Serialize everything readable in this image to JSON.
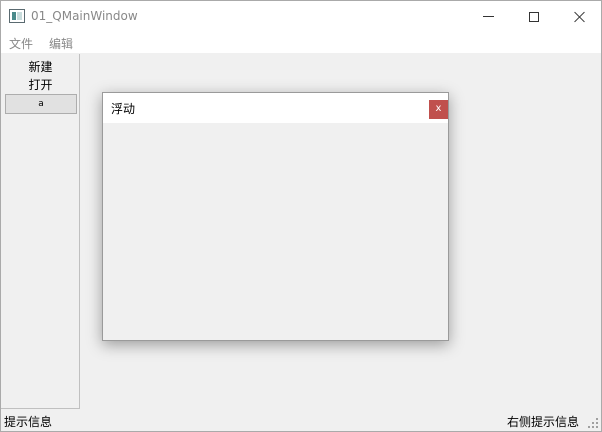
{
  "window": {
    "title": "01_QMainWindow",
    "icon": "app-window-icon"
  },
  "menubar": {
    "file_label": "文件",
    "edit_label": "编辑"
  },
  "dock": {
    "new_label": "新建",
    "open_label": "打开",
    "button_label": "a"
  },
  "floating_window": {
    "title": "浮动",
    "close_label": "x",
    "close_color": "#c0504d"
  },
  "statusbar": {
    "left_text": "提示信息",
    "right_text": "右侧提示信息"
  }
}
